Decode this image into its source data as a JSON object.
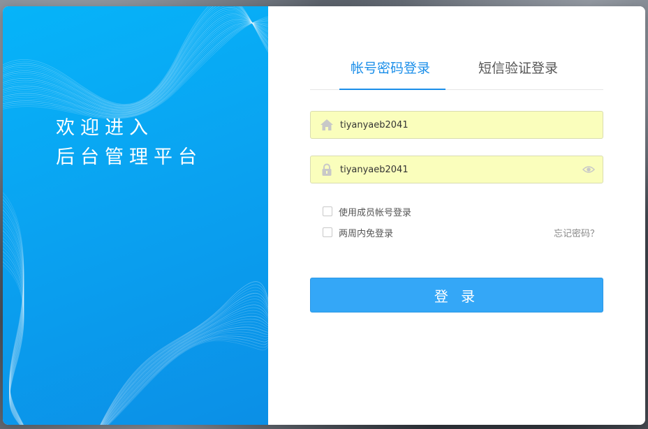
{
  "welcome": {
    "line1": "欢迎进入",
    "line2": "后台管理平台"
  },
  "tabs": [
    {
      "label": "帐号密码登录",
      "active": true
    },
    {
      "label": "短信验证登录",
      "active": false
    }
  ],
  "username": {
    "value": "tiyanyaeb2041",
    "icon": "home-icon"
  },
  "password": {
    "value": "tiyanyaeb2041",
    "icon": "lock-icon",
    "toggle_icon": "eye-icon"
  },
  "options": {
    "member_login": "使用成员帐号登录",
    "remember": "两周内免登录",
    "forgot": "忘记密码？"
  },
  "login_button": "登 录",
  "colors": {
    "accent": "#1a8ee9",
    "button": "#34a7f7",
    "panel_gradient_start": "#06b4f9",
    "panel_gradient_end": "#0b8fe6",
    "autofill": "#fafebc"
  }
}
